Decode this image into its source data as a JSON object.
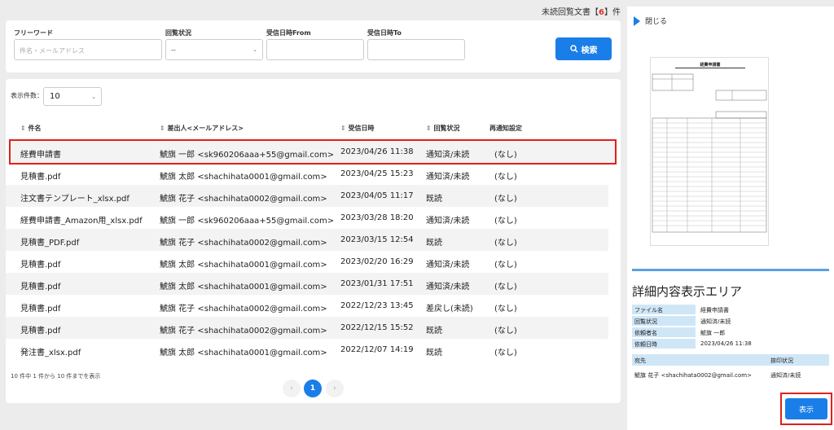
{
  "unread": {
    "label_pre": "未読回覧文書【",
    "count": "6",
    "label_post": "】件"
  },
  "search": {
    "freeword_label": "フリーワード",
    "freeword_placeholder": "件名・メールアドレス",
    "status_label": "回覧状況",
    "status_value": "--",
    "from_label": "受信日時From",
    "to_label": "受信日時To",
    "button_label": "検索"
  },
  "list": {
    "per_page_label": "表示件数：",
    "per_page_value": "10",
    "columns": [
      "件名",
      "差出人<メールアドレス>",
      "受信日時",
      "回覧状況",
      "再通知設定"
    ],
    "rows": [
      {
        "subject": "経費申請書",
        "sender": "鯱旗 一郎 <sk960206aaa+55@gmail.com>",
        "date": "2023/04/26 11:38",
        "status": "通知済/未読",
        "renotify": "(なし)"
      },
      {
        "subject": "見積書.pdf",
        "sender": "鯱旗 太郎 <shachihata0001@gmail.com>",
        "date": "2023/04/25 15:23",
        "status": "通知済/未読",
        "renotify": "(なし)"
      },
      {
        "subject": "注文書テンプレート_xlsx.pdf",
        "sender": "鯱旗 花子 <shachihata0002@gmail.com>",
        "date": "2023/04/05 11:17",
        "status": "既読",
        "renotify": "(なし)"
      },
      {
        "subject": "経費申請書_Amazon用_xlsx.pdf",
        "sender": "鯱旗 一郎 <sk960206aaa+55@gmail.com>",
        "date": "2023/03/28 18:20",
        "status": "通知済/未読",
        "renotify": "(なし)"
      },
      {
        "subject": "見積書_PDF.pdf",
        "sender": "鯱旗 花子 <shachihata0002@gmail.com>",
        "date": "2023/03/15 12:54",
        "status": "既読",
        "renotify": "(なし)"
      },
      {
        "subject": "見積書.pdf",
        "sender": "鯱旗 太郎 <shachihata0001@gmail.com>",
        "date": "2023/02/20 16:29",
        "status": "通知済/未読",
        "renotify": "(なし)"
      },
      {
        "subject": "見積書.pdf",
        "sender": "鯱旗 太郎 <shachihata0001@gmail.com>",
        "date": "2023/01/31 17:51",
        "status": "通知済/未読",
        "renotify": "(なし)"
      },
      {
        "subject": "見積書.pdf",
        "sender": "鯱旗 花子 <shachihata0002@gmail.com>",
        "date": "2022/12/23 13:45",
        "status": "差戻し(未読)",
        "renotify": "(なし)"
      },
      {
        "subject": "見積書.pdf",
        "sender": "鯱旗 花子 <shachihata0002@gmail.com>",
        "date": "2022/12/15 15:52",
        "status": "既読",
        "renotify": "(なし)"
      },
      {
        "subject": "発注書_xlsx.pdf",
        "sender": "鯱旗 太郎 <shachihata0001@gmail.com>",
        "date": "2022/12/07 14:19",
        "status": "既読",
        "renotify": "(なし)"
      }
    ],
    "pagination_info": "10 件中 1 件から 10 件までを表示",
    "current_page": "1"
  },
  "preview": {
    "close_label": "閉じる",
    "doc_title": "経費申請書",
    "detail_title": "詳細内容表示エリア",
    "fields": [
      {
        "key": "ファイル名",
        "value": "経費申請書"
      },
      {
        "key": "回覧状況",
        "value": "通知済/未読"
      },
      {
        "key": "依頼者名",
        "value": "鯱旗 一郎"
      },
      {
        "key": "依頼日時",
        "value": "2023/04/26 11:38"
      }
    ],
    "recipient_header": "宛先",
    "stamp_status_header": "捺印状況",
    "recipient": "鯱旗 花子 <shachihata0002@gmail.com>",
    "recipient_status": "通知済/未読",
    "show_button": "表示"
  },
  "colors": {
    "accent": "#1a7ee8",
    "highlight": "#e0201a",
    "unread_count": "#e0302a"
  }
}
